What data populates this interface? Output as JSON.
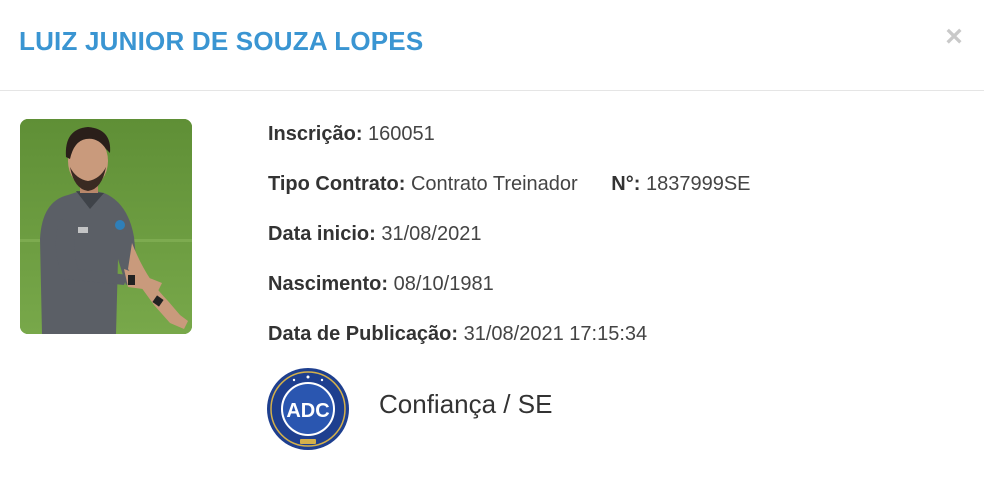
{
  "modal": {
    "title": "LUIZ JUNIOR DE SOUZA LOPES",
    "close_symbol": "×"
  },
  "person": {
    "photo_icon": "person-photo",
    "fields": {
      "inscricao": {
        "label": "Inscrição:",
        "value": "160051"
      },
      "tipo_contrato": {
        "label": "Tipo Contrato:",
        "value": "Contrato Treinador"
      },
      "numero": {
        "label": "N°:",
        "value": "1837999SE"
      },
      "data_inicio": {
        "label": "Data inicio:",
        "value": "31/08/2021"
      },
      "nascimento": {
        "label": "Nascimento:",
        "value": "08/10/1981"
      },
      "data_publicacao": {
        "label": "Data de Publicação:",
        "value": "31/08/2021 17:15:34"
      }
    }
  },
  "club": {
    "name": "Confiança / SE",
    "logo_letters": "ADC",
    "logo_icon": "club-crest-icon"
  },
  "colors": {
    "title": "#3a95d2",
    "close": "#c9c9c9",
    "crest_blue": "#1e3f8f",
    "crest_gold": "#d4b04a"
  }
}
